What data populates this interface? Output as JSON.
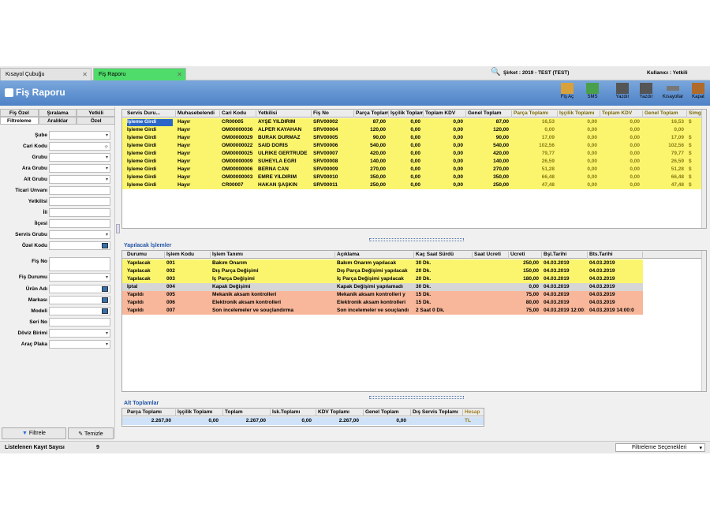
{
  "tabs": {
    "tab1": "Kısayol Çubuğu",
    "tab2": "Fiş Raporu"
  },
  "header": {
    "company": "Şirket : 2019 - TEST (TEST)",
    "user": "Kullanıcı : Yetkili"
  },
  "page": {
    "title": "Fiş Raporu"
  },
  "toolbar": {
    "fis_ac": "Fiş Aç",
    "sms": "SMS",
    "yazdir1": "Yazdır",
    "yazdir2": "Yazdır",
    "kisayollar": "Kısayollar",
    "kapat": "Kapat"
  },
  "left": {
    "tabs1": [
      "Fiş Özel",
      "Şıralama",
      "Yetkili"
    ],
    "tabs2": [
      "Filtreleme",
      "Aralıklar",
      "Özel"
    ],
    "fields": [
      {
        "label": "Şube",
        "type": "dd"
      },
      {
        "label": "Cari Kodu",
        "type": "pick"
      },
      {
        "label": "Grubu",
        "type": "dd"
      },
      {
        "label": "Ara Grubu",
        "type": "dd"
      },
      {
        "label": "Alt Grubu",
        "type": "dd"
      },
      {
        "label": "Ticari Unvanı",
        "type": "text"
      },
      {
        "label": "Yetkilisi",
        "type": "text"
      },
      {
        "label": "İli",
        "type": "text"
      },
      {
        "label": "İlçesi",
        "type": "text"
      },
      {
        "label": "Servis Grubu",
        "type": "dd"
      },
      {
        "label": "Özel Kodu",
        "type": "sq"
      },
      {
        "label": "Fiş No",
        "type": "text2"
      },
      {
        "label": "Fiş Durumu",
        "type": "dd"
      },
      {
        "label": "Ürün Adı",
        "type": "sq"
      },
      {
        "label": "Markası",
        "type": "sq"
      },
      {
        "label": "Modeli",
        "type": "sq"
      },
      {
        "label": "Seri No",
        "type": "text"
      },
      {
        "label": "Döviz Birimi",
        "type": "dd"
      },
      {
        "label": "Araç Plaka",
        "type": "dd"
      }
    ],
    "filter_btn": "Filtrele",
    "clear_btn": "Temizle"
  },
  "main": {
    "columns": [
      "Servis Duru...",
      "Muhasebelendi",
      "Cari Kodu",
      "Yetkilisi",
      "Fiş No",
      "Parça Toplamı",
      "İşçilik Toplamı",
      "Toplam KDV",
      "Genel Toplam",
      "Parça Toplamı",
      "İşçilik Toplamı",
      "Toplam KDV",
      "Genel Toplam",
      "Simge"
    ],
    "rows": [
      [
        "İşleme Girdi",
        "Hayır",
        "CR00005",
        "AYŞE YILDIRIM",
        "SRV00002",
        "87,00",
        "0,00",
        "0,00",
        "87,00",
        "16,53",
        "0,00",
        "0,00",
        "16,53",
        "$"
      ],
      [
        "İşleme Girdi",
        "Hayır",
        "OM00000036",
        "ALPER KAYAHAN",
        "SRV00004",
        "120,00",
        "0,00",
        "0,00",
        "120,00",
        "0,00",
        "0,00",
        "0,00",
        "0,00",
        ""
      ],
      [
        "İşleme Girdi",
        "Hayır",
        "OM00000029",
        "BURAK DURMAZ",
        "SRV00005",
        "90,00",
        "0,00",
        "0,00",
        "90,00",
        "17,09",
        "0,00",
        "0,00",
        "17,09",
        "$"
      ],
      [
        "İşleme Girdi",
        "Hayır",
        "OM00000022",
        "SAİD DORİS",
        "SRV00006",
        "540,00",
        "0,00",
        "0,00",
        "540,00",
        "102,56",
        "0,00",
        "0,00",
        "102,56",
        "$"
      ],
      [
        "İşleme Girdi",
        "Hayır",
        "OM00000025",
        "ULRİKE GERTRUDE",
        "SRV00007",
        "420,00",
        "0,00",
        "0,00",
        "420,00",
        "79,77",
        "0,00",
        "0,00",
        "79,77",
        "$"
      ],
      [
        "İşleme Girdi",
        "Hayır",
        "OM00000009",
        "SÜHEYLA EĞRİ",
        "SRV00008",
        "140,00",
        "0,00",
        "0,00",
        "140,00",
        "26,59",
        "0,00",
        "0,00",
        "26,59",
        "$"
      ],
      [
        "İşleme Girdi",
        "Hayır",
        "OM00000006",
        "BERNA CAN",
        "SRV00009",
        "270,00",
        "0,00",
        "0,00",
        "270,00",
        "51,28",
        "0,00",
        "0,00",
        "51,28",
        "$"
      ],
      [
        "İşleme Girdi",
        "Hayır",
        "OM00000003",
        "EMRE YILDIRIM",
        "SRV00010",
        "350,00",
        "0,00",
        "0,00",
        "350,00",
        "66,48",
        "0,00",
        "0,00",
        "66,48",
        "$"
      ],
      [
        "İşleme Girdi",
        "Hayır",
        "CR00007",
        "HAKAN ŞAŞKIN",
        "SRV00011",
        "250,00",
        "0,00",
        "0,00",
        "250,00",
        "47,48",
        "0,00",
        "0,00",
        "47,48",
        "$"
      ]
    ]
  },
  "ops": {
    "title": "Yapılacak İşlemler",
    "columns": [
      "Durumu",
      "İşlem Kodu",
      "İşlem Tanımı",
      "Açıklama",
      "Kaç Saat Sürdü",
      "Saat Ücreti",
      "Ücreti",
      "Bşl.Tarihi",
      "Bts.Tarihi"
    ],
    "rows": [
      {
        "c": [
          "Yapılacak",
          "001",
          "Bakım Onarım",
          "Bakım Onarım yapılacak",
          "30 Dk.",
          "",
          "250,00",
          "04.03.2019",
          "04.03.2019"
        ],
        "s": "y"
      },
      {
        "c": [
          "Yapılacak",
          "002",
          "Dış Parça Değişimi",
          "Dış Parça Değişimi yapılacak",
          "20 Dk.",
          "",
          "150,00",
          "04.03.2019",
          "04.03.2019"
        ],
        "s": "y"
      },
      {
        "c": [
          "Yapılacak",
          "003",
          "İç Parça Değişimi",
          "İç Parça Değişimi yapılacak",
          "20 Dk.",
          "",
          "180,00",
          "04.03.2019",
          "04.03.2019"
        ],
        "s": "y"
      },
      {
        "c": [
          "İptal",
          "004",
          "Kapak Değişimi",
          "Kapak Değişimi yapılamadı",
          "30 Dk.",
          "",
          "0,00",
          "04.03.2019",
          "04.03.2019"
        ],
        "s": "g"
      },
      {
        "c": [
          "Yapıldı",
          "005",
          "Mekanik aksam kontrolleri",
          "Mekanik aksam kontrolleri y",
          "15 Dk.",
          "",
          "75,00",
          "04.03.2019",
          "04.03.2019"
        ],
        "s": "o"
      },
      {
        "c": [
          "Yapıldı",
          "006",
          "Elektronik aksam kontrolleri",
          "Elektronik aksam kontrolleri",
          "15 Dk.",
          "",
          "80,00",
          "04.03.2019",
          "04.03.2019"
        ],
        "s": "o"
      },
      {
        "c": [
          "Yapıldı",
          "007",
          "Son incelemeler ve souçlandırma",
          "Son incelemeler ve souçlandı",
          "2 Saat 0 Dk.",
          "",
          "75,00",
          "04.03.2019 12:00:0",
          "04.03.2019 14:00:0"
        ],
        "s": "o"
      }
    ]
  },
  "totals": {
    "title": "Alt Toplamlar",
    "columns": [
      "Parça Toplamı",
      "İşçilik Toplamı",
      "Toplam",
      "İsk.Toplamı",
      "KDV Toplamı",
      "Genel Toplam",
      "Dış Servis Toplamı",
      "Hesap"
    ],
    "values": [
      "2.267,00",
      "0,00",
      "2.267,00",
      "0,00",
      "2.267,00",
      "0,00",
      "TL"
    ]
  },
  "status": {
    "label": "Listelenen Kayıt Sayısı",
    "count": "9",
    "dropdown": "Filtreleme Seçenekleri"
  }
}
